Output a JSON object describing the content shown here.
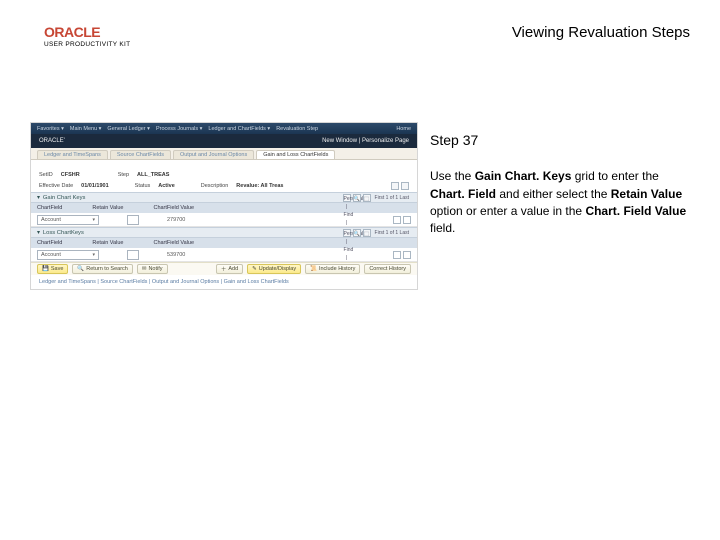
{
  "header": {
    "brand_logo": "ORACLE",
    "brand_sub": "USER PRODUCTIVITY KIT",
    "page_title": "Viewing Revaluation Steps"
  },
  "panel": {
    "step_title": "Step 37",
    "instr_pre": "Use the ",
    "instr_b1": "Gain Chart. Keys",
    "instr_mid1": " grid to enter the ",
    "instr_b2": "Chart. Field",
    "instr_mid2": " and either select the ",
    "instr_b3": "Retain Value",
    "instr_mid3": " option or enter a value in the ",
    "instr_b4": "Chart. Field Value",
    "instr_end": " field."
  },
  "mock": {
    "top": {
      "left_items": [
        "Favorites ▾",
        "Main Menu ▾",
        "General Ledger ▾",
        "Process Journals ▾",
        "Ledger and ChartFields ▾",
        "Revaluation Step"
      ],
      "home": "Home"
    },
    "brand_bar": {
      "label": "ORACLE'",
      "right": "New Window | Personalize Page"
    },
    "tabs": [
      "Ledger and TimeSpans",
      "Source ChartFields",
      "Output and Journal Options",
      "Gain and Loss ChartFields"
    ],
    "active_tab": 3,
    "row1": {
      "l1": "SetID",
      "v1": "CFSHR",
      "l2": "Step",
      "v2": "ALL_TREAS"
    },
    "row2": {
      "l1": "Effective Date",
      "v1": "01/01/1901",
      "l2": "Status",
      "v2": "Active",
      "l3": "Description",
      "v3": "Revalue: All Treas"
    },
    "sec1": {
      "title": "Gain Chart Keys",
      "toolbar": "Personalize | Find | ",
      "nav": "First  1 of 1  Last",
      "cols": [
        "ChartField",
        "Retain Value",
        "ChartField Value"
      ],
      "cf": "Account",
      "rv": "",
      "cfv": "279700"
    },
    "sec2": {
      "title": "Loss ChartKeys",
      "toolbar": "Personalize | Find | ",
      "nav": "First  1 of 1  Last",
      "cols": [
        "ChartField",
        "Retain Value",
        "ChartField Value"
      ],
      "cf": "Account",
      "rv": "",
      "cfv": "539700"
    },
    "buttons": {
      "save": "Save",
      "ret": "Return to Search",
      "notify": "Notify",
      "add": "Add",
      "upd": "Update/Display",
      "hist": "Include History",
      "corr": "Correct History"
    },
    "crumb": "Ledger and TimeSpans | Source ChartFields | Output and Journal Options | Gain and Loss ChartFields"
  }
}
